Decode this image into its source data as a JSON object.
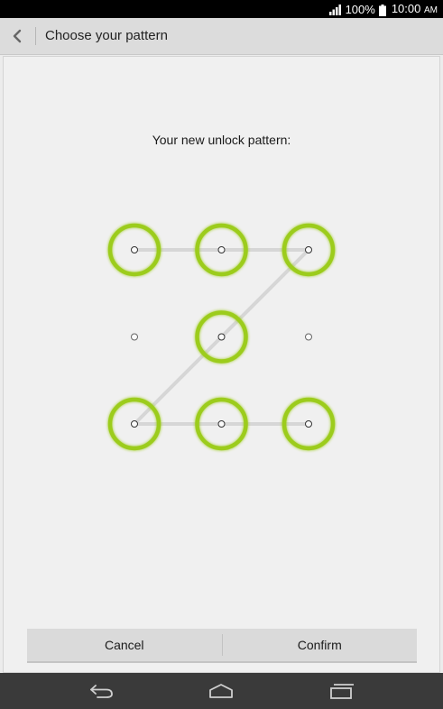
{
  "status_bar": {
    "battery": "100%",
    "time": "10:00",
    "ampm": "AM"
  },
  "action_bar": {
    "title": "Choose your pattern"
  },
  "pattern_screen": {
    "header": "Your new unlock pattern:"
  },
  "buttons": {
    "cancel": "Cancel",
    "confirm": "Confirm"
  },
  "pattern": {
    "grid_size": 3,
    "selected_sequence": [
      1,
      2,
      3,
      5,
      7,
      8,
      9
    ],
    "active_ring_color": "#9ccc1c",
    "line_color": "#d6d6d6"
  },
  "nav_bar": {
    "icons": [
      "back-icon",
      "home-icon",
      "recent-apps-icon"
    ]
  }
}
